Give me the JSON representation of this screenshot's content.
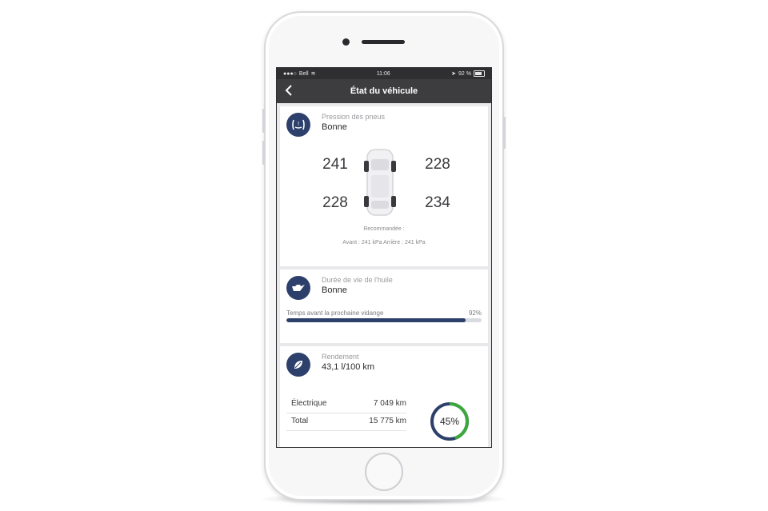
{
  "status_bar": {
    "carrier": "Bell",
    "time": "11:06",
    "battery": "92 %"
  },
  "nav": {
    "title": "État du véhicule"
  },
  "tires": {
    "label": "Pression des pneus",
    "status": "Bonne",
    "front_left": "241",
    "front_right": "228",
    "rear_left": "228",
    "rear_right": "234",
    "recommended_label": "Recommandée :",
    "recommended_values": "Avant : 241 kPa Arrière : 241 kPa"
  },
  "oil": {
    "label": "Durée de vie de l'huile",
    "status": "Bonne",
    "progress_label": "Temps avant la prochaine vidange",
    "progress_text": "92%",
    "progress_fraction": 0.92
  },
  "efficiency": {
    "label": "Rendement",
    "value": "43,1 l/100 km",
    "rows": [
      {
        "label": "Électrique",
        "value": "7 049 km"
      },
      {
        "label": "Total",
        "value": "15 775 km"
      }
    ],
    "ring_text": "45%",
    "ring_fraction": 0.45
  },
  "colors": {
    "accent_navy": "#2d3f6b",
    "ring_green": "#3aa83a",
    "nav_dark": "#3d3d40"
  },
  "icons": {
    "tire": "tire-pressure-icon",
    "oil": "oil-can-icon",
    "leaf": "leaf-icon",
    "back": "chevron-left-icon"
  }
}
